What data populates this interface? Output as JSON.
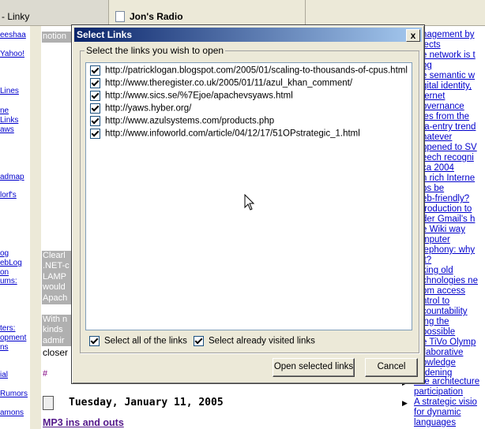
{
  "browser": {
    "tab1_title": "- Linky",
    "tab2_title": "Jon's Radio"
  },
  "left_links": [
    "eeshaa",
    "Yahoo!",
    "Lines",
    "ne",
    "Links",
    "aws",
    "admap",
    "lorf's",
    "og",
    "ebLog",
    "on",
    "ums:",
    "ters:",
    "opment",
    "ns",
    "ial",
    "Rumors",
    "amons"
  ],
  "background": {
    "gray_lines_1": [
      "notion"
    ],
    "gray_lines_2": [
      "Clearl",
      ".NET-c",
      "LAMP",
      "would",
      "Apach"
    ],
    "gray_lines_3": [
      "With n",
      "kinds",
      "admir"
    ],
    "closer_text": "closer",
    "hash": "#",
    "date": "Tuesday, January 11, 2005",
    "post_title": "MP3 ins and outs"
  },
  "right_links": [
    "nagement by",
    "jects",
    "e network is t",
    "og",
    "e semantic w",
    "gital identity,",
    "ternet",
    "overnance",
    "les from the",
    "ta-entry trend",
    "hatever",
    "ppened to SV",
    "eech recogni",
    "ca 2004",
    "n rich Interne",
    "ps be",
    "eb-friendly?",
    "troduction to",
    "der Gmail's h",
    "e Wiki way",
    "mputer",
    "lephony: why",
    "it?",
    "king old",
    "chnologies ne",
    "om access",
    "ntrol to",
    "countability",
    "ing the",
    "possible",
    "e TiVo Olymp",
    "llaborative",
    "owledge",
    "rdening"
  ],
  "right_links_bottom": [
    "The architecture",
    "participation",
    "A strategic visio",
    "for dynamic",
    "languages"
  ],
  "dialog": {
    "title": "Select Links",
    "close_glyph": "x",
    "group_label": "Select the links you wish to open",
    "links": [
      "http://patricklogan.blogspot.com/2005/01/scaling-to-thousands-of-cpus.html",
      "http://www.theregister.co.uk/2005/01/11/azul_khan_comment/",
      "http://www.sics.se/%7Ejoe/apachevsyaws.html",
      "http://yaws.hyber.org/",
      "http://www.azulsystems.com/products.php",
      "http://www.infoworld.com/article/04/12/17/51OPstrategic_1.html"
    ],
    "select_all_label": "Select all of the links",
    "select_visited_label": "Select already visited links",
    "open_button": "Open selected links",
    "cancel_button": "Cancel"
  }
}
